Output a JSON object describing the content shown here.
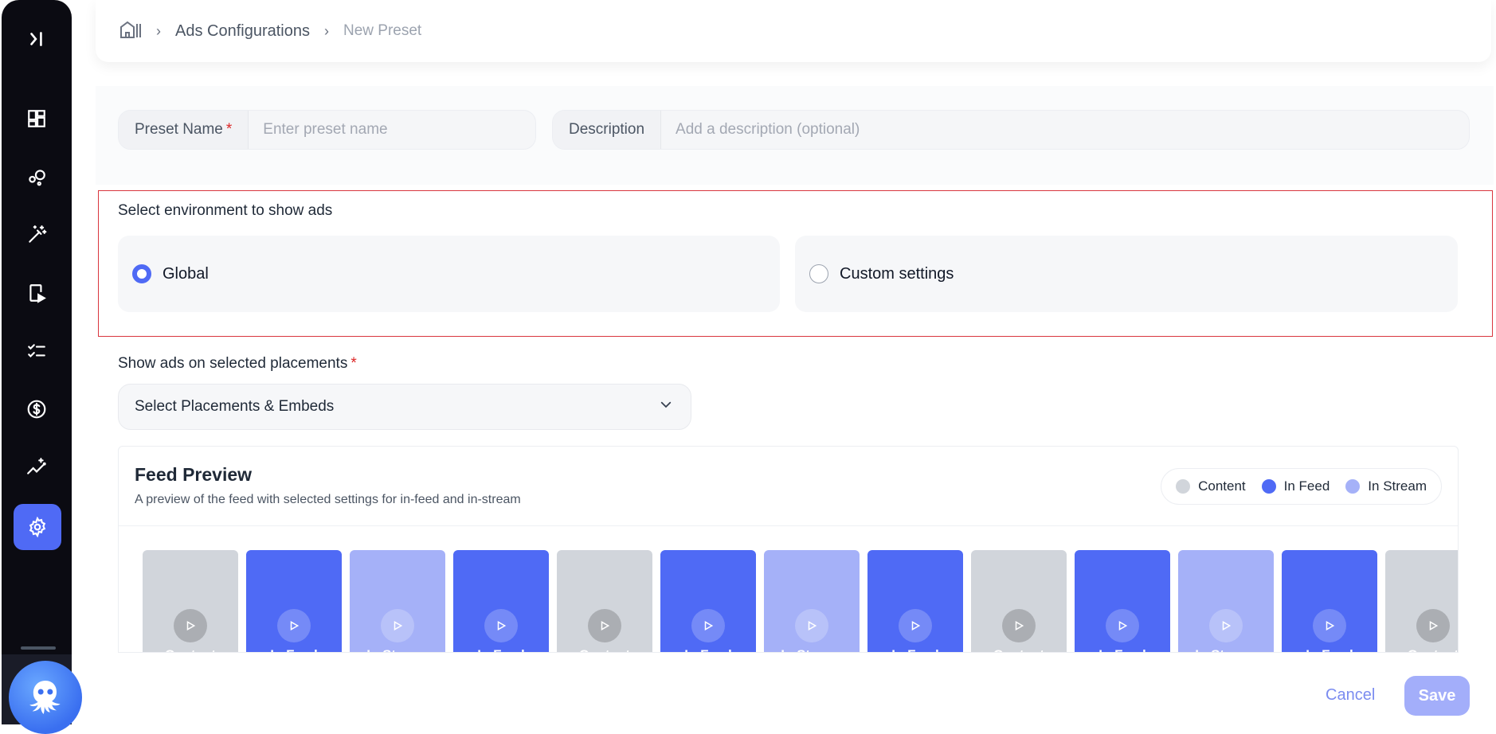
{
  "sidebar": {
    "items": [
      {
        "icon": "expand-sidebar-icon"
      },
      {
        "icon": "dashboard-icon"
      },
      {
        "icon": "bubbles-icon"
      },
      {
        "icon": "magic-wand-icon"
      },
      {
        "icon": "mobile-video-icon"
      },
      {
        "icon": "checklist-icon"
      },
      {
        "icon": "dollar-icon"
      },
      {
        "icon": "trend-sparkle-icon"
      },
      {
        "icon": "settings-icon",
        "active": true
      }
    ],
    "avatar_icon": "octopus-icon"
  },
  "breadcrumb": {
    "home_icon": "home-icon",
    "items": [
      "Ads Configurations",
      "New Preset"
    ]
  },
  "form": {
    "preset_name": {
      "label": "Preset Name",
      "required_mark": "*",
      "value": "",
      "placeholder": "Enter preset name"
    },
    "description": {
      "label": "Description",
      "value": "",
      "placeholder": "Add a description (optional)"
    }
  },
  "environment": {
    "title": "Select environment to show ads",
    "options": [
      {
        "label": "Global",
        "selected": true
      },
      {
        "label": "Custom settings",
        "selected": false
      }
    ]
  },
  "placements": {
    "title": "Show ads on selected placements",
    "required_mark": "*",
    "select_value": "Select Placements & Embeds"
  },
  "feed_preview": {
    "title": "Feed Preview",
    "subtitle": "A preview of the feed with selected settings for in-feed and in-stream",
    "legend": [
      {
        "label": "Content",
        "color": "#d1d5db"
      },
      {
        "label": "In Feed",
        "color": "#4f6af5"
      },
      {
        "label": "In Stream",
        "color": "#a5b1f8"
      }
    ],
    "tiles": [
      {
        "label": "Content",
        "kind": "content"
      },
      {
        "label": "In Feed",
        "kind": "blue"
      },
      {
        "label": "In Stream",
        "kind": "light"
      },
      {
        "label": "In Feed",
        "kind": "blue"
      },
      {
        "label": "Content",
        "kind": "content"
      },
      {
        "label": "In Feed",
        "kind": "blue"
      },
      {
        "label": "In Stream",
        "kind": "light"
      },
      {
        "label": "In Feed",
        "kind": "blue"
      },
      {
        "label": "Content",
        "kind": "content"
      },
      {
        "label": "In Feed",
        "kind": "blue"
      },
      {
        "label": "In Stream",
        "kind": "light"
      },
      {
        "label": "In Feed",
        "kind": "blue"
      },
      {
        "label": "Content",
        "kind": "content"
      }
    ]
  },
  "actions": {
    "cancel": "Cancel",
    "save": "Save"
  },
  "colors": {
    "accent": "#4f6af5",
    "highlight_border": "#d9363e"
  }
}
